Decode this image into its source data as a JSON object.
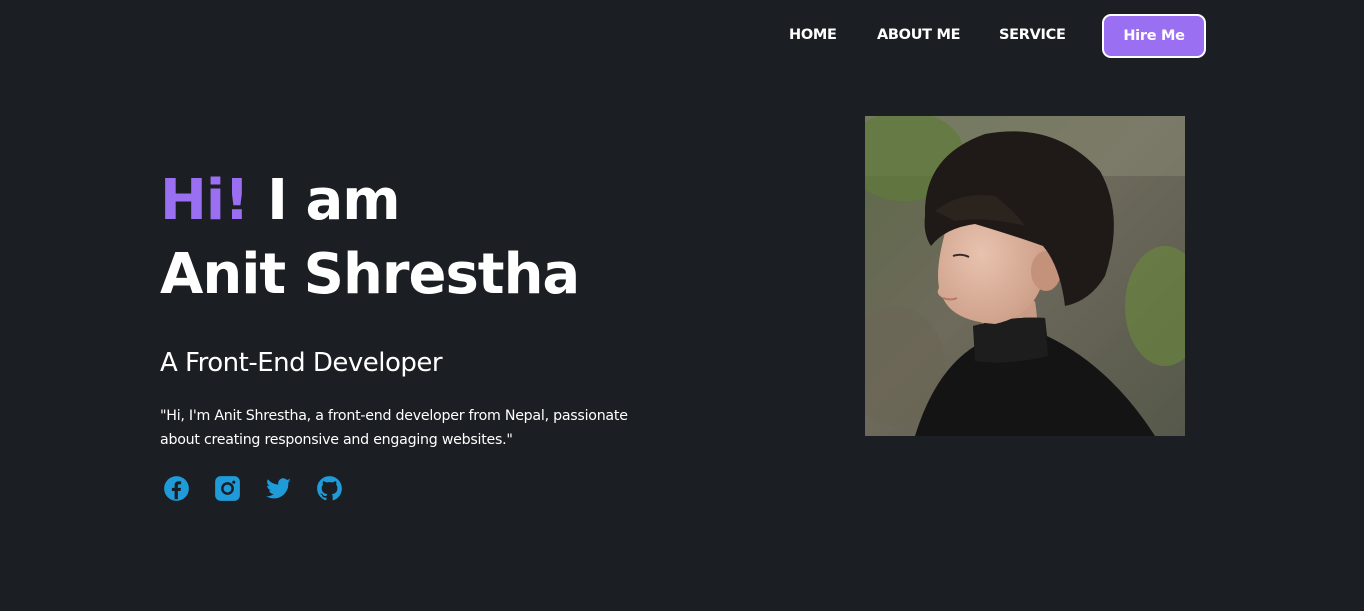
{
  "nav": {
    "home_label": "HOME",
    "about_label": "ABOUT ME",
    "service_label": "SERVICE",
    "hire_label": "Hire Me"
  },
  "hero": {
    "greeting": "Hi!",
    "intro": " I am",
    "name": "Anit Shrestha",
    "role": "A Front-End Developer",
    "bio": "\"Hi, I'm Anit Shrestha, a front-end developer from Nepal, passionate about creating responsive and engaging websites.\""
  },
  "socials": [
    {
      "icon": "facebook-icon"
    },
    {
      "icon": "instagram-icon"
    },
    {
      "icon": "twitter-icon"
    },
    {
      "icon": "github-icon"
    }
  ],
  "colors": {
    "background": "#1b1e22",
    "accent": "#9b6ff2",
    "social": "#1f9bd9",
    "text": "#ffffff"
  }
}
